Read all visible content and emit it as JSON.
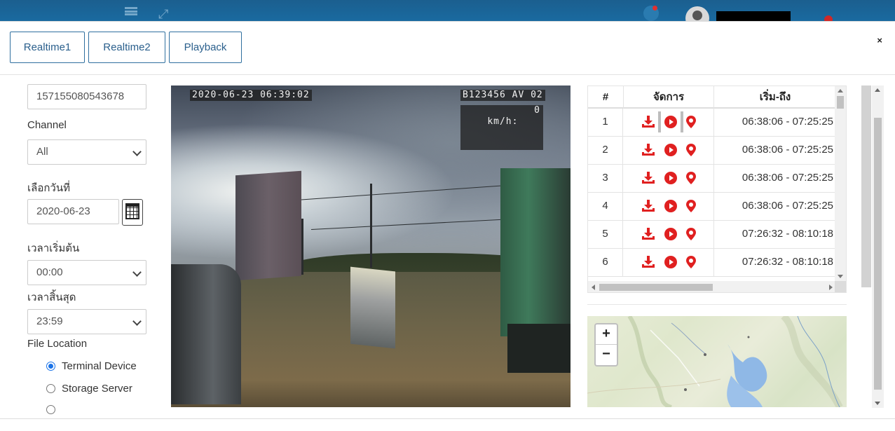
{
  "tabs": [
    "Realtime1",
    "Realtime2",
    "Playback"
  ],
  "close_label": "×",
  "form": {
    "device_id": "157155080543678",
    "channel_label": "Channel",
    "channel_value": "All",
    "date_label": "เลือกวันที่",
    "date_value": "2020-06-23",
    "start_time_label": "เวลาเริ่มต้น",
    "start_time_value": "00:00",
    "end_time_label": "เวลาสิ้นสุด",
    "end_time_value": "23:59",
    "file_location_label": "File Location",
    "file_location_options": [
      "Terminal Device",
      "Storage Server"
    ],
    "file_location_selected": "Terminal Device"
  },
  "video": {
    "timestamp": "2020-06-23 06:39:02",
    "plate_info": "B123456 AV 02",
    "speed_label": "km/h:",
    "speed_value": "0"
  },
  "table": {
    "headers": [
      "#",
      "จัดการ",
      "เริ่ม-ถึง"
    ],
    "rows": [
      {
        "no": "1",
        "time": "06:38:06 - 07:25:25",
        "active": true
      },
      {
        "no": "2",
        "time": "06:38:06 - 07:25:25",
        "active": false
      },
      {
        "no": "3",
        "time": "06:38:06 - 07:25:25",
        "active": false
      },
      {
        "no": "4",
        "time": "06:38:06 - 07:25:25",
        "active": false
      },
      {
        "no": "5",
        "time": "07:26:32 - 08:10:18",
        "active": false
      },
      {
        "no": "6",
        "time": "07:26:32 - 08:10:18",
        "active": false
      }
    ],
    "action_icons": [
      "download-icon",
      "play-icon",
      "map-pin-icon"
    ]
  },
  "map": {
    "zoom_in": "+",
    "zoom_out": "−"
  },
  "colors": {
    "accent": "#2a5f8c",
    "action_red": "#e02020",
    "radio_blue": "#1a73e8",
    "nav_bg": "#1b5f8f"
  }
}
